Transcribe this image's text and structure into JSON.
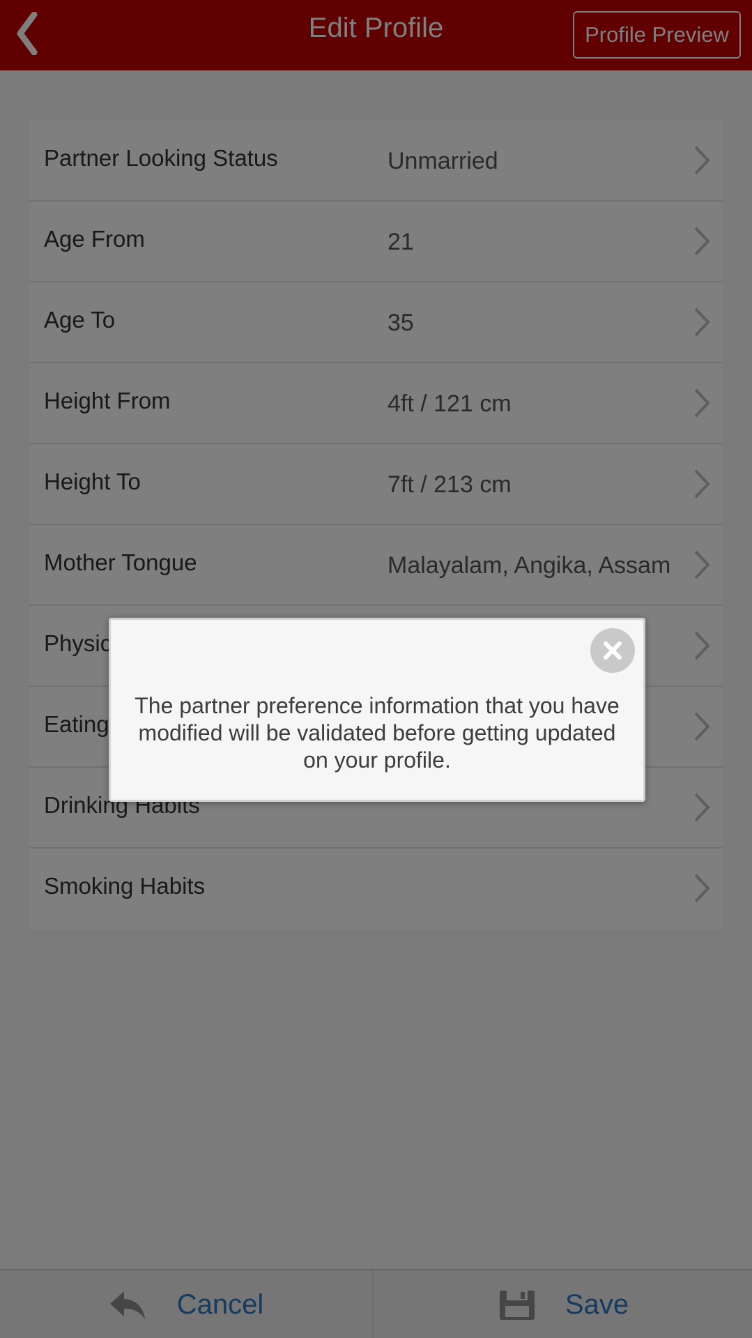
{
  "header": {
    "title": "Edit Profile",
    "preview_label": "Profile Preview",
    "back_icon": "chevron-left-icon",
    "bg_color": "#c00000"
  },
  "fields": [
    {
      "label": "Partner Looking Status",
      "value": "Unmarried"
    },
    {
      "label": "Age From",
      "value": "21"
    },
    {
      "label": "Age To",
      "value": "35"
    },
    {
      "label": "Height From",
      "value": "4ft / 121 cm"
    },
    {
      "label": "Height To",
      "value": "7ft / 213 cm"
    },
    {
      "label": "Mother Tongue",
      "value": "Malayalam, Angika, Assam"
    },
    {
      "label": "Physical Status",
      "value": ""
    },
    {
      "label": "Eating Habits",
      "value": ""
    },
    {
      "label": "Drinking Habits",
      "value": ""
    },
    {
      "label": "Smoking Habits",
      "value": ""
    }
  ],
  "footer": {
    "cancel_label": "Cancel",
    "cancel_icon": "reply-icon",
    "save_label": "Save",
    "save_icon": "floppy-disk-icon",
    "accent_color": "#2f74c0"
  },
  "modal": {
    "message": "The partner preference information that you have modified will be validated before getting updated on your profile.",
    "close_icon": "close-icon"
  }
}
